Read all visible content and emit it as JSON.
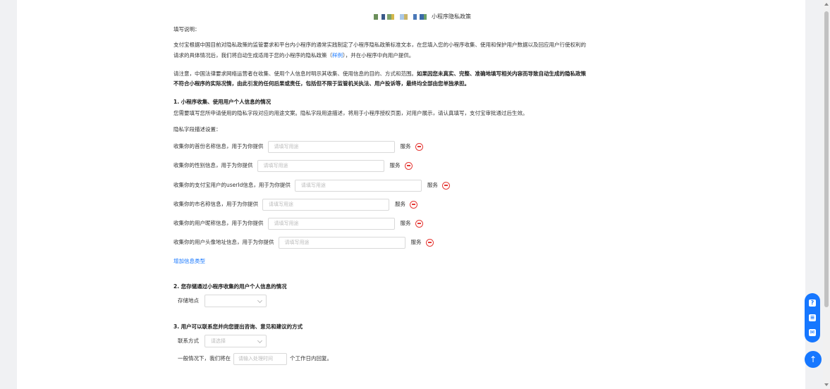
{
  "page": {
    "title": "小程序隐私政策",
    "intro_heading": "填写说明：",
    "intro_p1_a": "支付宝根据中国目前对隐私政策的监管要求和平台内小程序的通常实践制定了小程序隐私政策标准文本，在您填入您的小程序收集、使用和保护用户数据以及回应用户行使权利的",
    "intro_p1_b_pre": "请求的具体情况后，我们将自动生成适用于您的小程序的隐私政策（",
    "intro_p1_b_link": "样例",
    "intro_p1_b_post": "），并在小程序中向用户提供。",
    "intro_p2_a_normal": "请注意，中国法律要求网络运营者在收集、使用个人信息时明示其收集、使用信息的目的、方式和范围。",
    "intro_p2_a_bold": "如果因您未真实、完整、准确地填写相关内容而导致自动生成的隐私政策",
    "intro_p2_b": "不符合小程序的实际况情，由此引发的任何后果或责任，包括但不限于监管机关执法、用户投诉等，最终均全部由您单独承担。"
  },
  "section1": {
    "heading": "1. 小程序收集、使用用户个人信息的情况",
    "desc": "您需要填写您所申请使用的隐私字段对应的用途文案。隐私字段用途描述，将用于小程序授权页面，对用户展示，请认真填写，支付宝审批通过后生效。",
    "sub_label": "隐私字段描述设置：",
    "fields": [
      {
        "label": "收集你的首份名称信息，用于为你提供",
        "placeholder": "请填写用途",
        "suffix": "服务"
      },
      {
        "label": "收集你的性别信息，用于为你提供",
        "placeholder": "请填写用途",
        "suffix": "服务"
      },
      {
        "label": "收集你的支付宝用户的userId信息，用于为你提供",
        "placeholder": "请填写用途",
        "suffix": "服务"
      },
      {
        "label": "收集你的市名称信息，用于为你提供",
        "placeholder": "请填写用途",
        "suffix": "服务"
      },
      {
        "label": "收集你的用户昵称信息，用于为你提供",
        "placeholder": "请填写用途",
        "suffix": "服务"
      },
      {
        "label": "收集你的用户头像地址信息，用于为你提供",
        "placeholder": "请填写用途",
        "suffix": "服务"
      }
    ],
    "add_link": "增加信息类型"
  },
  "section2": {
    "heading": "2. 您存储通过小程序收集的用户个人信息的情况",
    "storage_label": "存储地点",
    "storage_value": ""
  },
  "section3": {
    "heading": "3. 用户可以联系您并向您提出咨询、意见和建议的方式",
    "contact_label": "联系方式",
    "contact_placeholder": "请选择",
    "reply_pre": "一般情况下，我们将在",
    "reply_placeholder": "请输入处理时间",
    "reply_post": "个工作日内回复。"
  },
  "colors": {
    "accent": "#1677ff",
    "danger": "#e53935"
  },
  "icons": {
    "remove": "minus-circle-icon",
    "help": "question-icon",
    "chat": "chat-icon",
    "mail": "mail-icon",
    "top": "arrow-up-icon"
  }
}
